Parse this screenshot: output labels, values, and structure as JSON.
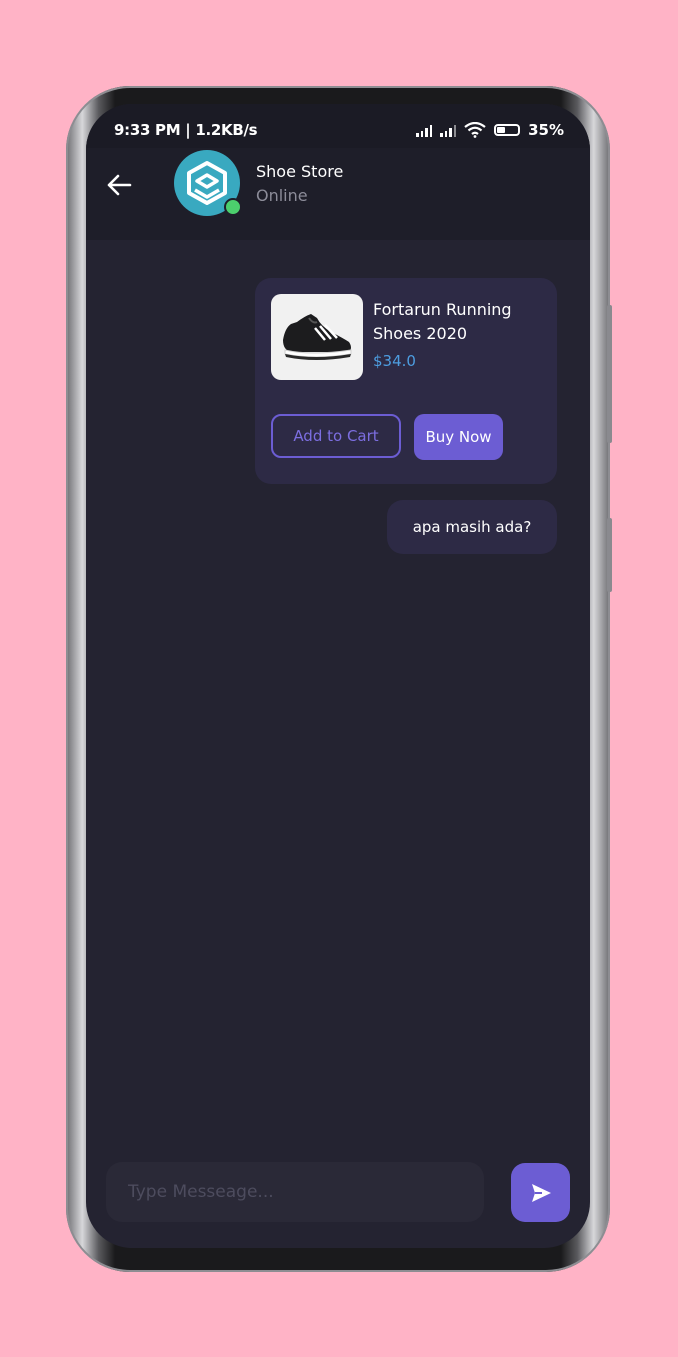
{
  "status_bar": {
    "left_text": "9:33 PM | 1.2KB/s",
    "battery_percent": "35%",
    "icons": [
      "mute-icon",
      "nfc-icon",
      "telegram-icon",
      "signal-icon",
      "signal-icon",
      "wifi-icon",
      "battery-icon"
    ]
  },
  "header": {
    "back_icon": "arrow-left-icon",
    "store_name": "Shoe Store",
    "status": "Online",
    "avatar_icon": "store-logo-icon",
    "online_color": "#4ccf6d"
  },
  "messages": {
    "product_card": {
      "name": "Fortarun Running Shoes 2020",
      "price": "$34.0",
      "add_to_cart_label": "Add to Cart",
      "buy_now_label": "Buy Now"
    },
    "text_message": "apa masih ada?"
  },
  "composer": {
    "placeholder": "Type Messeage...",
    "value": "",
    "send_icon": "send-icon"
  },
  "colors": {
    "accent": "#6c5dd3",
    "background": "#242331",
    "bubble": "#2d2a45",
    "price": "#4d9de0",
    "page_bg": "#ffb3c6"
  }
}
